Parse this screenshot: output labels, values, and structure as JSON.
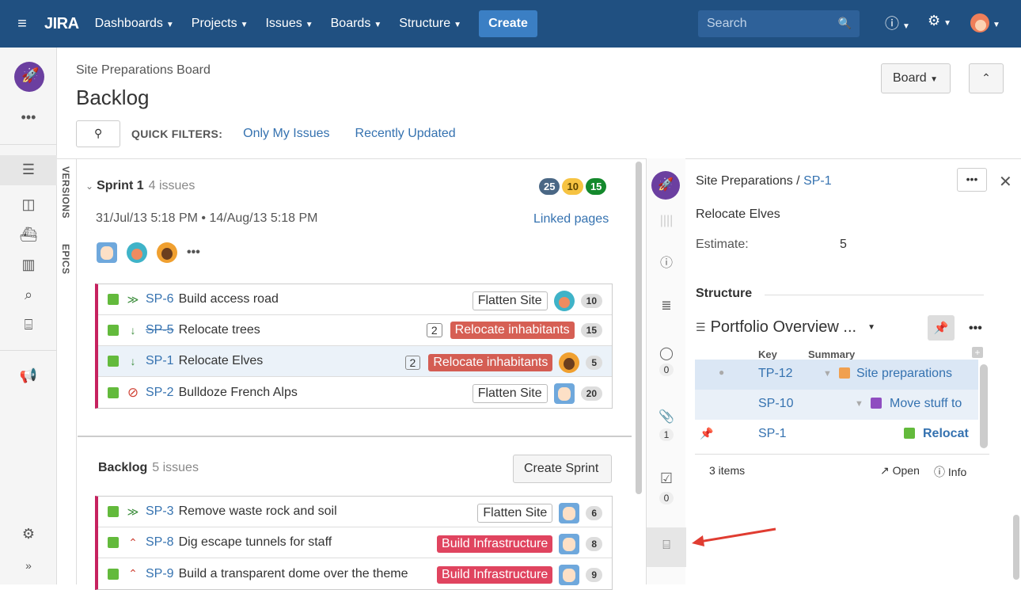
{
  "nav": {
    "logo": "JIRA",
    "items": [
      "Dashboards",
      "Projects",
      "Issues",
      "Boards",
      "Structure"
    ],
    "create": "Create",
    "search_placeholder": "Search"
  },
  "header": {
    "board_name": "Site Preparations Board",
    "title": "Backlog",
    "quick_filters_label": "QUICK FILTERS:",
    "filters": [
      "Only My Issues",
      "Recently Updated"
    ],
    "board_button": "Board"
  },
  "side_tabs": [
    "VERSIONS",
    "EPICS"
  ],
  "sprint": {
    "name": "Sprint 1",
    "count": "4 issues",
    "badges": [
      "25",
      "10",
      "15"
    ],
    "dates": "31/Jul/13 5:18 PM • 14/Aug/13 5:18 PM",
    "linked": "Linked pages",
    "issues": [
      {
        "key": "SP-6",
        "summary": "Build access road",
        "epic": "Flatten Site",
        "points": "10"
      },
      {
        "key": "SP-5",
        "summary": "Relocate trees",
        "subtasks": "2",
        "epic": "Relocate inhabitants",
        "points": "15"
      },
      {
        "key": "SP-1",
        "summary": "Relocate Elves",
        "subtasks": "2",
        "epic": "Relocate inhabitants",
        "points": "5"
      },
      {
        "key": "SP-2",
        "summary": "Bulldoze French Alps",
        "epic": "Flatten Site",
        "points": "20"
      }
    ]
  },
  "backlog": {
    "name": "Backlog",
    "count": "5 issues",
    "create_sprint": "Create Sprint",
    "issues": [
      {
        "key": "SP-3",
        "summary": "Remove waste rock and soil",
        "epic": "Flatten Site",
        "points": "6"
      },
      {
        "key": "SP-8",
        "summary": "Dig escape tunnels for staff",
        "epic": "Build Infrastructure",
        "points": "8"
      },
      {
        "key": "SP-9",
        "summary": "Build a transparent dome over the theme",
        "epic": "Build Infrastructure",
        "points": "9"
      }
    ]
  },
  "detail": {
    "project": "Site Preparations",
    "key": "SP-1",
    "title": "Relocate Elves",
    "estimate_label": "Estimate:",
    "estimate": "5",
    "comment_count": "0",
    "attach_count": "1",
    "check_count": "0",
    "section": "Structure",
    "structure_name": "Portfolio Overview ...",
    "col_key": "Key",
    "col_summary": "Summary",
    "rows": [
      {
        "key": "TP-12",
        "summary": "Site preparations"
      },
      {
        "key": "SP-10",
        "summary": "Move stuff to"
      },
      {
        "key": "SP-1",
        "summary": "Relocat"
      }
    ],
    "items": "3 items",
    "open": "Open",
    "info": "Info"
  }
}
